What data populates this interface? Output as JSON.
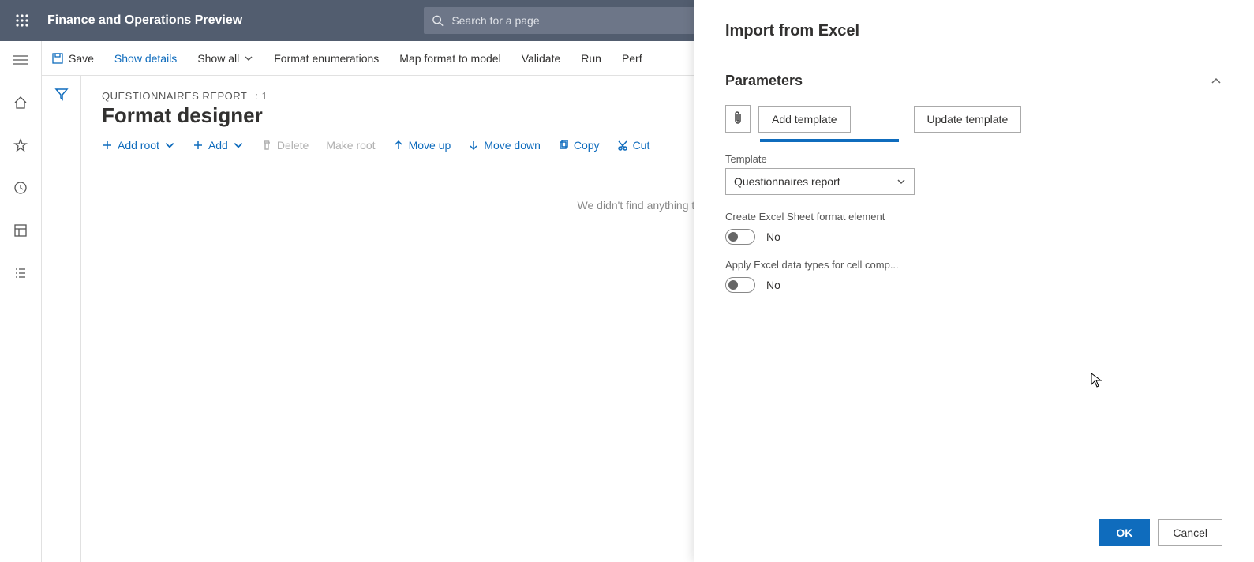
{
  "header": {
    "app_title": "Finance and Operations Preview",
    "search_placeholder": "Search for a page"
  },
  "toolbar": {
    "save": "Save",
    "show_details": "Show details",
    "show_all": "Show all",
    "format_enum": "Format enumerations",
    "map_format": "Map format to model",
    "validate": "Validate",
    "run": "Run",
    "perf": "Perf"
  },
  "main": {
    "breadcrumb_label": "QUESTIONNAIRES REPORT",
    "breadcrumb_index": ": 1",
    "page_title": "Format designer",
    "actions": {
      "add_root": "Add root",
      "add": "Add",
      "delete": "Delete",
      "make_root": "Make root",
      "move_up": "Move up",
      "move_down": "Move down",
      "copy": "Copy",
      "cut": "Cut"
    },
    "empty_text": "We didn't find anything to show here."
  },
  "panel": {
    "title": "Import from Excel",
    "section_title": "Parameters",
    "buttons": {
      "add_template": "Add template",
      "update_template": "Update template"
    },
    "template_label": "Template",
    "template_value": "Questionnaires report",
    "create_sheet_label": "Create Excel Sheet format element",
    "create_sheet_value": "No",
    "apply_types_label": "Apply Excel data types for cell comp...",
    "apply_types_value": "No",
    "ok": "OK",
    "cancel": "Cancel"
  }
}
